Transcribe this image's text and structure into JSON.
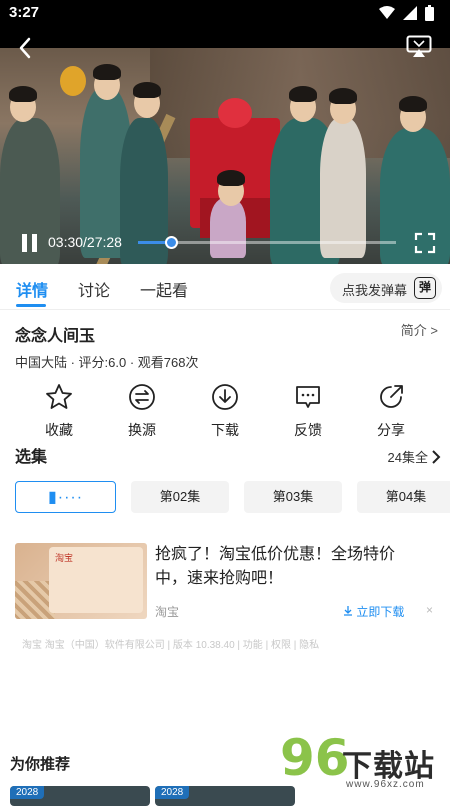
{
  "status_bar": {
    "time": "3:27"
  },
  "player": {
    "current_time": "03:30",
    "duration": "27:28",
    "time_display": "03:30/27:28",
    "progress_fraction": 0.128,
    "accent_color": "#3b8de8"
  },
  "tabs": {
    "items": [
      {
        "label": "详情",
        "active": true
      },
      {
        "label": "讨论",
        "active": false
      },
      {
        "label": "一起看",
        "active": false
      }
    ],
    "danmu_label": "点我发弹幕",
    "danmu_icon_text": "弹"
  },
  "show": {
    "title": "念念人间玉",
    "intro_label": "简介 >",
    "meta": "中国大陆 · 评分:6.0 · 观看768次"
  },
  "actions": [
    {
      "label": "收藏",
      "icon": "star-icon"
    },
    {
      "label": "换源",
      "icon": "swap-icon"
    },
    {
      "label": "下载",
      "icon": "download-icon"
    },
    {
      "label": "反馈",
      "icon": "feedback-icon"
    },
    {
      "label": "分享",
      "icon": "share-icon"
    }
  ],
  "episodes": {
    "heading": "选集",
    "all_label": "24集全",
    "items": [
      {
        "label": "",
        "playing": true
      },
      {
        "label": "第02集",
        "playing": false
      },
      {
        "label": "第03集",
        "playing": false
      },
      {
        "label": "第04集",
        "playing": false
      }
    ]
  },
  "ad": {
    "headline": "抢疯了！淘宝低价优惠！全场特价中，速来抢购吧！",
    "source": "淘宝",
    "download_label": "立即下载",
    "close_glyph": "×",
    "footer": "淘宝 淘宝（中国）软件有限公司 | 版本 10.38.40 | 功能 | 权限 | 隐私",
    "thumb_title": "淘宝"
  },
  "recommend": {
    "heading": "为你推荐",
    "cards": [
      {
        "year": "2028"
      },
      {
        "year": "2028"
      }
    ]
  },
  "watermark": {
    "number": "96",
    "text": "下载站",
    "url": "www.96xz.com"
  }
}
